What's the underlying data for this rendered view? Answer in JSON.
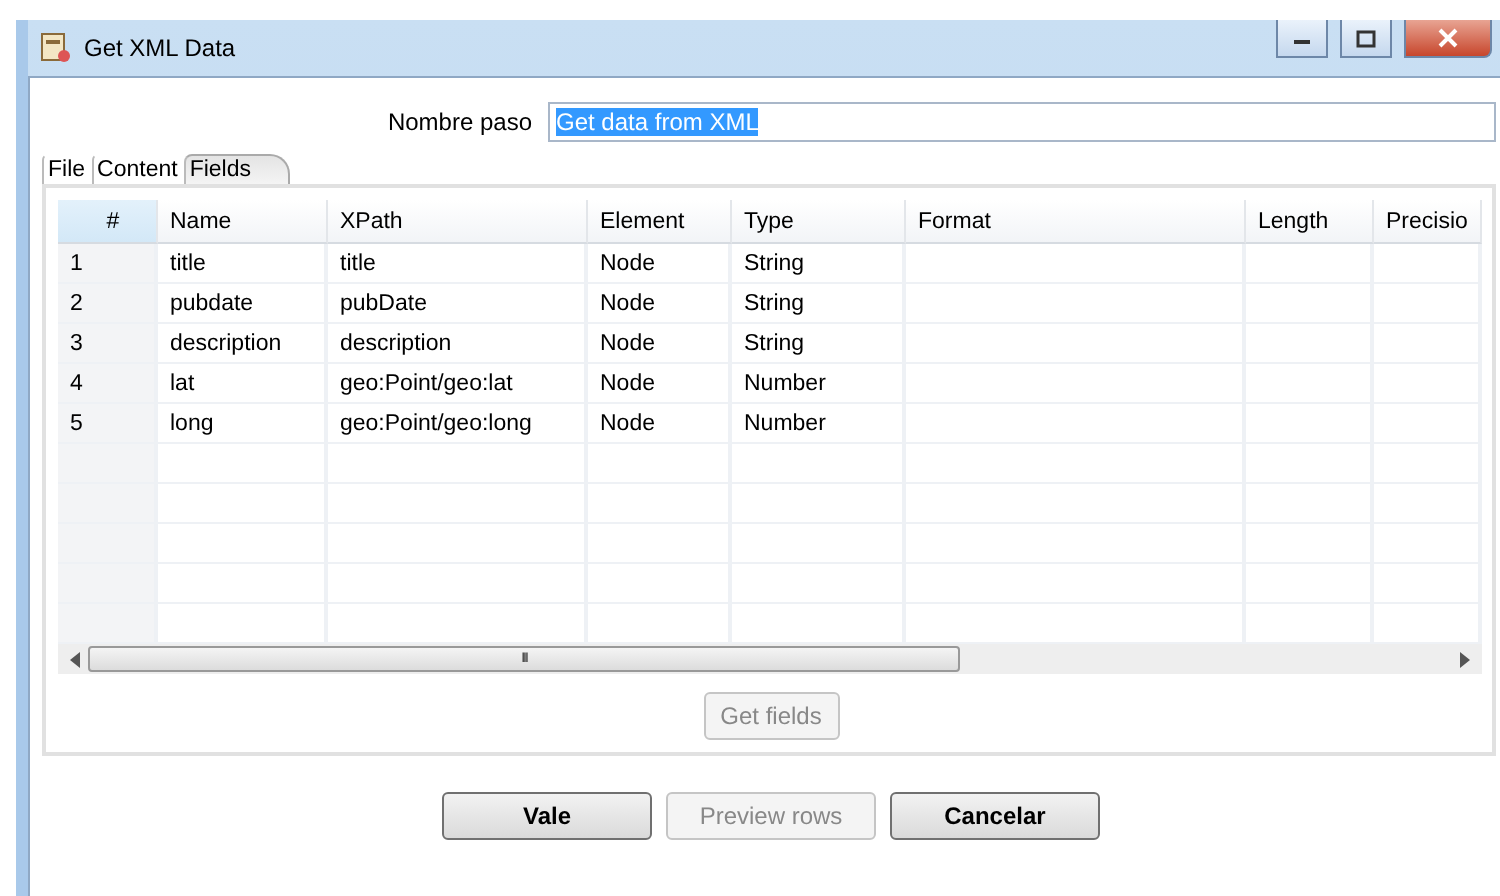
{
  "window": {
    "title": "Get XML Data"
  },
  "step_name": {
    "label": "Nombre paso",
    "value": "Get data from XML",
    "highlighted": true
  },
  "tabs": [
    {
      "label": "File",
      "selected": false
    },
    {
      "label": "Content",
      "selected": false
    },
    {
      "label": "Fields",
      "selected": true
    }
  ],
  "table": {
    "columns": [
      "#",
      "Name",
      "XPath",
      "Element",
      "Type",
      "Format",
      "Length",
      "Precisio"
    ],
    "rows": [
      [
        "1",
        "title",
        "title",
        "Node",
        "String",
        "",
        "",
        ""
      ],
      [
        "2",
        "pubdate",
        "pubDate",
        "Node",
        "String",
        "",
        "",
        ""
      ],
      [
        "3",
        "description",
        "description",
        "Node",
        "String",
        "",
        "",
        ""
      ],
      [
        "4",
        "lat",
        "geo:Point/geo:lat",
        "Node",
        "Number",
        "",
        "",
        ""
      ],
      [
        "5",
        "long",
        "geo:Point/geo:long",
        "Node",
        "Number",
        "",
        "",
        ""
      ]
    ],
    "scroll_thumb": "III"
  },
  "get_fields": {
    "label": "Get fields",
    "disabled": true
  },
  "buttons": [
    {
      "label": "Vale",
      "disabled": false
    },
    {
      "label": "Preview rows",
      "disabled": true
    },
    {
      "label": "Cancelar",
      "disabled": false
    }
  ]
}
